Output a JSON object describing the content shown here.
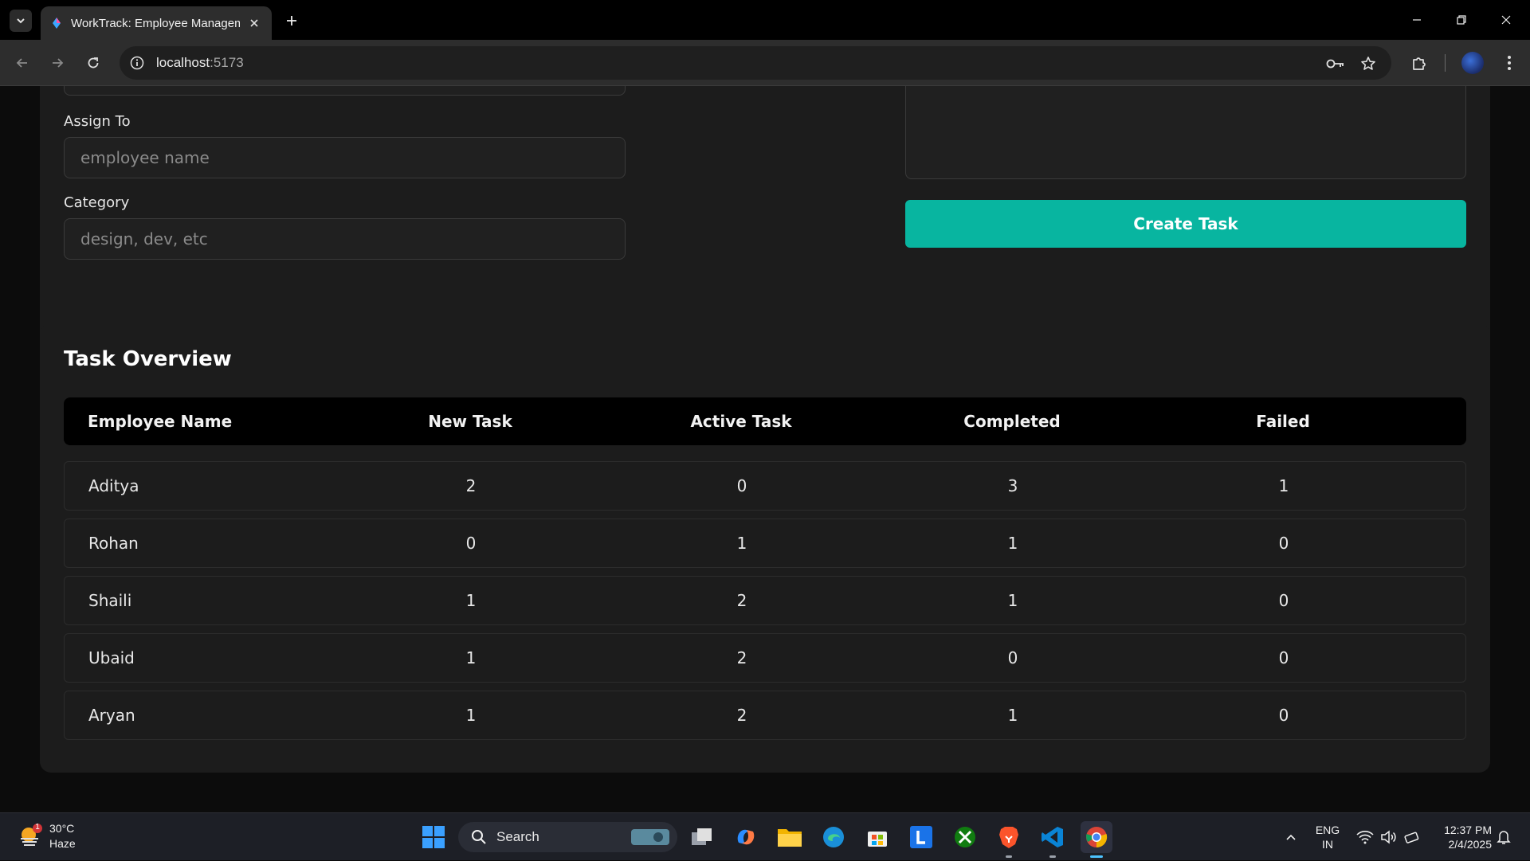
{
  "browser": {
    "tab_title": "WorkTrack: Employee Managem",
    "url_host": "localhost",
    "url_port": ":5173"
  },
  "form": {
    "assign_label": "Assign To",
    "assign_placeholder": "employee name",
    "category_label": "Category",
    "category_placeholder": "design, dev, etc",
    "create_button": "Create Task"
  },
  "overview": {
    "title": "Task Overview",
    "headers": [
      "Employee Name",
      "New Task",
      "Active Task",
      "Completed",
      "Failed"
    ],
    "rows": [
      {
        "name": "Aditya",
        "new": "2",
        "active": "0",
        "completed": "3",
        "failed": "1"
      },
      {
        "name": "Rohan",
        "new": "0",
        "active": "1",
        "completed": "1",
        "failed": "0"
      },
      {
        "name": "Shaili",
        "new": "1",
        "active": "2",
        "completed": "1",
        "failed": "0"
      },
      {
        "name": "Ubaid",
        "new": "1",
        "active": "2",
        "completed": "0",
        "failed": "0"
      },
      {
        "name": "Aryan",
        "new": "1",
        "active": "2",
        "completed": "1",
        "failed": "0"
      }
    ]
  },
  "taskbar": {
    "weather_temp": "30°C",
    "weather_desc": "Haze",
    "weather_badge": "1",
    "search_label": "Search",
    "lang_line1": "ENG",
    "lang_line2": "IN",
    "time": "12:37 PM",
    "date": "2/4/2025"
  },
  "colors": {
    "accent": "#08b5a0",
    "card_bg": "#1c1c1c",
    "page_bg": "#0c0c0c"
  }
}
